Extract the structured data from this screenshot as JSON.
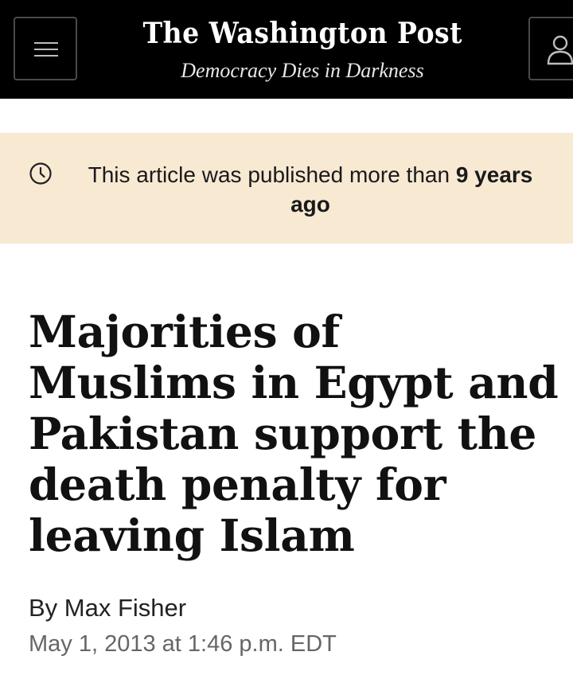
{
  "header": {
    "logo_text": "The Washington Post",
    "tagline": "Democracy Dies in Darkness",
    "menu_icon": "hamburger-menu-icon",
    "account_icon": "user-icon"
  },
  "notice": {
    "icon": "clock-icon",
    "text_prefix": "This article was published more than ",
    "text_bold": "9 years",
    "text_suffix": " ago"
  },
  "article": {
    "headline": "Majorities of Muslims in Egypt and Pakistan support the death penalty for leaving Islam",
    "byline_prefix": "By ",
    "author": "Max Fisher",
    "date": "May 1, 2013 at 1:46 p.m. EDT"
  },
  "colors": {
    "header_bg": "#000000",
    "notice_bg": "#f8e9d3",
    "text": "#111111",
    "date_text": "#666666"
  }
}
